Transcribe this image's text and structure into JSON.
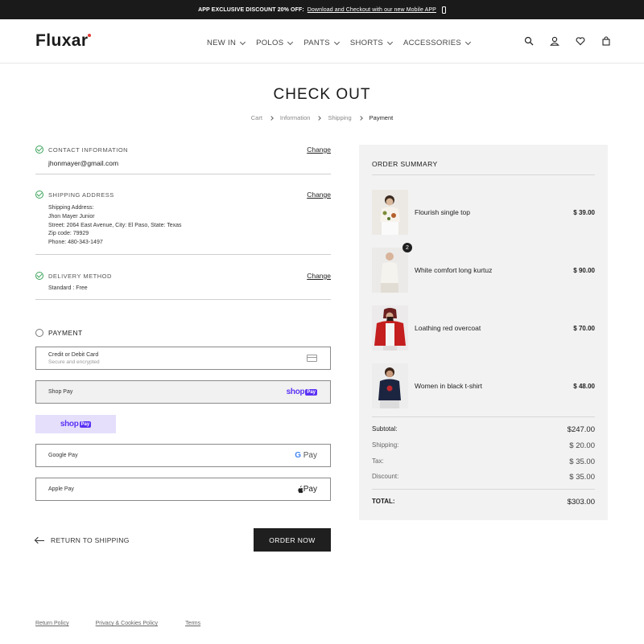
{
  "topbar": {
    "lead": "APP EXCLUSIVE DISCOUNT 20% OFF:",
    "link": "Download and Checkout with our new Mobile APP",
    "icon": "phone-icon"
  },
  "header": {
    "logo": "Fluxar",
    "nav": [
      "NEW IN",
      "POLOS",
      "PANTS",
      "SHORTS",
      "ACCESSORIES"
    ],
    "icons": [
      "search-icon",
      "user-icon",
      "heart-icon",
      "bag-icon"
    ]
  },
  "page": {
    "title": "CHECK OUT",
    "breadcrumb": [
      "Cart",
      "Information",
      "Shipping",
      "Payment"
    ]
  },
  "contact": {
    "title": "CONTACT INFORMATION",
    "change": "Change",
    "email": "jhonmayer@gmail.com"
  },
  "shipping": {
    "title": "SHIPPING ADDRESS",
    "change": "Change",
    "lines": [
      "Shipping Address:",
      "Jhon Mayer Junior",
      "Street: 2064 East Avenue, City: El Paso, State: Texas",
      "Zip code: 79929",
      "Phone: 480-343-1497"
    ]
  },
  "delivery": {
    "title": "DELIVERY METHOD",
    "change": "Change",
    "value": "Standard : Free"
  },
  "payment": {
    "title": "PAYMENT",
    "card_label": "Credit or Debit Card",
    "card_sub": "Secure and encrypted",
    "shop_pay_label": "Shop Pay",
    "shop_word": "shop",
    "pay_word": "Pay",
    "google_label": "Google Pay",
    "google_g": "G",
    "apple_label": "Apple Pay",
    "apple_logo": "",
    "selected_bg": "#f1f1f1",
    "shop_color": "#5a31f4"
  },
  "actions": {
    "return": "RETURN TO SHIPPING",
    "order": "ORDER NOW"
  },
  "summary": {
    "title": "ORDER SUMMARY",
    "items": [
      {
        "name": "Flourish single top",
        "price": "$ 39.00",
        "badge": ""
      },
      {
        "name": "White comfort long kurtuz",
        "price": "$ 90.00",
        "badge": "2"
      },
      {
        "name": "Loathing red overcoat",
        "price": "$ 70.00",
        "badge": ""
      },
      {
        "name": "Women in black t-shirt",
        "price": "$ 48.00",
        "badge": ""
      }
    ],
    "subtotal_label": "Subtotal:",
    "subtotal": "$247.00",
    "shipping_label": "Shipping:",
    "shipping": "$ 20.00",
    "tax_label": "Tax:",
    "tax": "$ 35.00",
    "discount_label": "Discount:",
    "discount": "$ 35.00",
    "total_label": "TOTAL:",
    "total": "$303.00"
  },
  "footer": {
    "links": [
      "Return Policy",
      "Privacy & Cookies Policy",
      "Terms"
    ]
  }
}
